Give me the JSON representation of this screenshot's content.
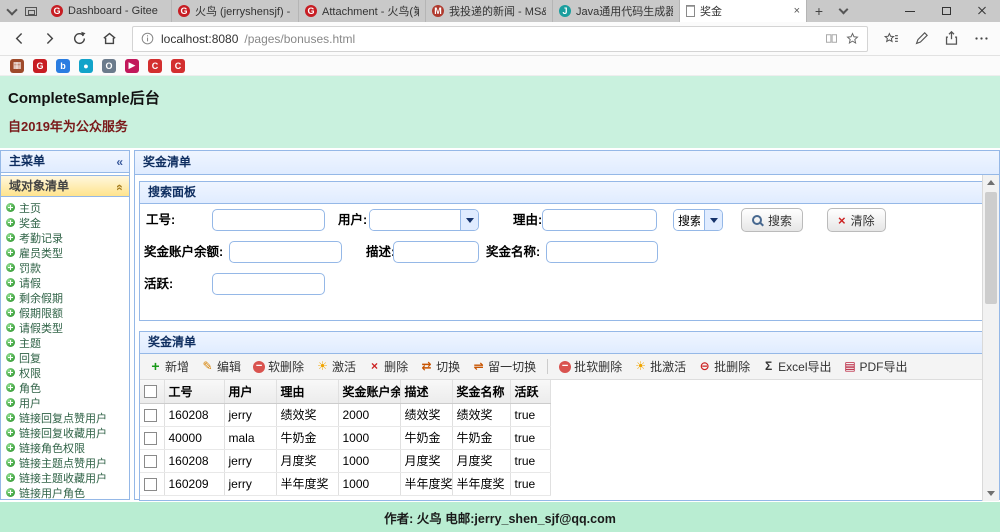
{
  "browser": {
    "tabs": [
      {
        "title": "Dashboard - Gitee",
        "icon": "gitee-favicon",
        "icon_color": "#c71d23",
        "icon_glyph": "G",
        "active": false
      },
      {
        "title": "火鸟 (jerryshensjf) - Git",
        "icon": "gitee-favicon",
        "icon_color": "#c71d23",
        "icon_glyph": "G",
        "active": false
      },
      {
        "title": "Attachment - 火鸟(第三",
        "icon": "gitee-favicon",
        "icon_color": "#c71d23",
        "icon_glyph": "G",
        "active": false
      },
      {
        "title": "我投递的新闻 - MS&A(",
        "icon": "news-favicon",
        "icon_color": "#b03a2e",
        "icon_glyph": "M",
        "active": false
      },
      {
        "title": "Java通用代码生成器光",
        "icon": "generator-favicon",
        "icon_color": "#1a9e9e",
        "icon_glyph": "J",
        "active": false
      },
      {
        "title": "奖金",
        "icon": "page-favicon",
        "icon_color": "#ffffff",
        "icon_glyph": "",
        "active": true
      }
    ],
    "url": {
      "host": "localhost:8080",
      "path": "/pages/bonuses.html"
    },
    "bookmarks": [
      {
        "icon": "bookmark-icon-1",
        "color": "#9e4a2a",
        "glyph": "▦"
      },
      {
        "icon": "bookmark-icon-2",
        "color": "#c71d23",
        "glyph": "G"
      },
      {
        "icon": "bookmark-icon-3",
        "color": "#2a7de1",
        "glyph": "b"
      },
      {
        "icon": "bookmark-icon-4",
        "color": "#12a3c9",
        "glyph": "●"
      },
      {
        "icon": "bookmark-icon-5",
        "color": "#6b7b8c",
        "glyph": "O"
      },
      {
        "icon": "bookmark-icon-6",
        "color": "#c2185b",
        "glyph": "▶"
      },
      {
        "icon": "bookmark-icon-7",
        "color": "#d32f2f",
        "glyph": "C"
      },
      {
        "icon": "bookmark-icon-8",
        "color": "#d32f2f",
        "glyph": "C"
      }
    ]
  },
  "page": {
    "title": "CompleteSample后台",
    "subtitle": "自2019年为公众服务",
    "footer": "作者: 火鸟 电邮:jerry_shen_sjf@qq.com"
  },
  "sidebar": {
    "title": "主菜单",
    "group_title": "域对象清单",
    "items": [
      "主页",
      "奖金",
      "考勤记录",
      "雇员类型",
      "罚款",
      "请假",
      "剩余假期",
      "假期限额",
      "请假类型",
      "主题",
      "回复",
      "权限",
      "角色",
      "用户",
      "链接回复点赞用户",
      "链接回复收藏用户",
      "链接角色权限",
      "链接主题点赞用户",
      "链接主题收藏用户",
      "链接用户角色"
    ]
  },
  "main": {
    "title": "奖金清单"
  },
  "search": {
    "title": "搜索面板",
    "fields": {
      "emp_no": {
        "label": "工号:",
        "value": ""
      },
      "user": {
        "label": "用户:",
        "value": ""
      },
      "reason": {
        "label": "理由:",
        "value": ""
      },
      "balance": {
        "label": "奖金账户余额:",
        "value": ""
      },
      "desc": {
        "label": "描述:",
        "value": ""
      },
      "bonus_name": {
        "label": "奖金名称:",
        "value": ""
      },
      "active": {
        "label": "活跃:",
        "value": ""
      }
    },
    "mode_select": "搜索",
    "buttons": {
      "search": "搜索",
      "clear": "清除"
    }
  },
  "grid": {
    "title": "奖金清单",
    "toolbar": [
      {
        "label": "新增",
        "icon": "add-icon"
      },
      {
        "label": "编辑",
        "icon": "edit-icon"
      },
      {
        "label": "软删除",
        "icon": "soft-delete-icon"
      },
      {
        "label": "激活",
        "icon": "activate-icon"
      },
      {
        "label": "删除",
        "icon": "delete-icon"
      },
      {
        "label": "切换",
        "icon": "toggle-icon"
      },
      {
        "label": "留一切换",
        "icon": "toggle-one-icon"
      },
      {
        "type": "sep"
      },
      {
        "label": "批软删除",
        "icon": "batch-soft-delete-icon"
      },
      {
        "label": "批激活",
        "icon": "batch-activate-icon"
      },
      {
        "label": "批删除",
        "icon": "batch-delete-icon"
      },
      {
        "label": "Excel导出",
        "icon": "excel-export-icon"
      },
      {
        "label": "PDF导出",
        "icon": "pdf-export-icon"
      }
    ],
    "columns": [
      "工号",
      "用户",
      "理由",
      "奖金账户余额",
      "描述",
      "奖金名称",
      "活跃"
    ],
    "rows": [
      [
        "160208",
        "jerry",
        "绩效奖",
        "2000",
        "绩效奖",
        "绩效奖",
        "true"
      ],
      [
        "40000",
        "mala",
        "牛奶金",
        "1000",
        "牛奶金",
        "牛奶金",
        "true"
      ],
      [
        "160208",
        "jerry",
        "月度奖",
        "1000",
        "月度奖",
        "月度奖",
        "true"
      ],
      [
        "160209",
        "jerry",
        "半年度奖",
        "1000",
        "半年度奖",
        "半年度奖",
        "true"
      ]
    ]
  },
  "icon_glyphs": {
    "new-tab-icon": "+",
    "close-icon": "×",
    "clear-icon": "×",
    "add-icon": "+",
    "edit-icon": "✎",
    "soft-delete-icon": "−",
    "activate-icon": "☀",
    "delete-icon": "×",
    "toggle-icon": "⇄",
    "toggle-one-icon": "⇌",
    "batch-soft-delete-icon": "−",
    "batch-activate-icon": "☀",
    "batch-delete-icon": "⊖",
    "excel-export-icon": "Σ",
    "pdf-export-icon": "▤"
  }
}
